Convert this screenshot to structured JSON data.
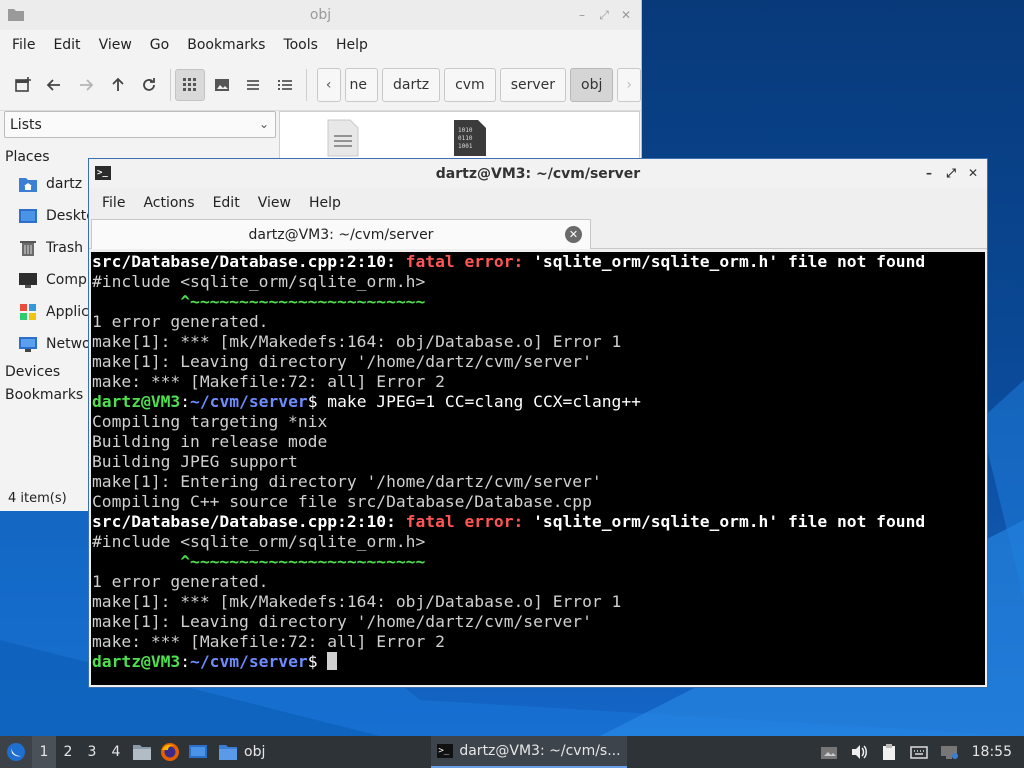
{
  "file_manager": {
    "title": "obj",
    "menu": [
      "File",
      "Edit",
      "View",
      "Go",
      "Bookmarks",
      "Tools",
      "Help"
    ],
    "breadcrumbs": [
      "ne",
      "dartz",
      "cvm",
      "server",
      "obj"
    ],
    "view_select": "Lists",
    "places_heading": "Places",
    "places": [
      {
        "label": "dartz",
        "icon": "home-folder-icon"
      },
      {
        "label": "Deskto",
        "icon": "desktop-icon"
      },
      {
        "label": "Trash",
        "icon": "trash-icon"
      },
      {
        "label": "Comp",
        "icon": "computer-icon"
      },
      {
        "label": "Applic",
        "icon": "applications-icon"
      },
      {
        "label": "Netwo",
        "icon": "network-icon"
      }
    ],
    "devices_heading": "Devices",
    "bookmarks_heading": "Bookmarks",
    "status": "4 item(s)"
  },
  "terminal": {
    "title": "dartz@VM3: ~/cvm/server",
    "menu": [
      "File",
      "Actions",
      "Edit",
      "View",
      "Help"
    ],
    "tab_label": "dartz@VM3: ~/cvm/server",
    "error_block": {
      "loc": "src/Database/Database.cpp:2:10: ",
      "fatal": "fatal error: ",
      "msg": "'sqlite_orm/sqlite_orm.h' file not found",
      "include": "#include <sqlite_orm/sqlite_orm.h>",
      "caret": "         ^~~~~~~~~~~~~~~~~~~~~~~~~",
      "generated": "1 error generated.",
      "make_err": "make[1]: *** [mk/Makedefs:164: obj/Database.o] Error 1",
      "leaving": "make[1]: Leaving directory '/home/dartz/cvm/server'",
      "make_all": "make: *** [Makefile:72: all] Error 2"
    },
    "prompt": {
      "user": "dartz@VM3",
      "colon": ":",
      "path": "~/cvm/server",
      "dollar": "$ "
    },
    "command": "make JPEG=1 CC=clang CCX=clang++",
    "build_output": [
      "Compiling targeting *nix",
      "Building in release mode",
      "Building JPEG support",
      "make[1]: Entering directory '/home/dartz/cvm/server'",
      "Compiling C++ source file src/Database/Database.cpp"
    ]
  },
  "taskbar": {
    "workspaces": [
      "1",
      "2",
      "3",
      "4"
    ],
    "tasks": [
      {
        "label": "obj",
        "icon": "folder-icon"
      },
      {
        "label": "dartz@VM3: ~/cvm/s...",
        "icon": "terminal-icon"
      }
    ],
    "clock": "18:55"
  }
}
